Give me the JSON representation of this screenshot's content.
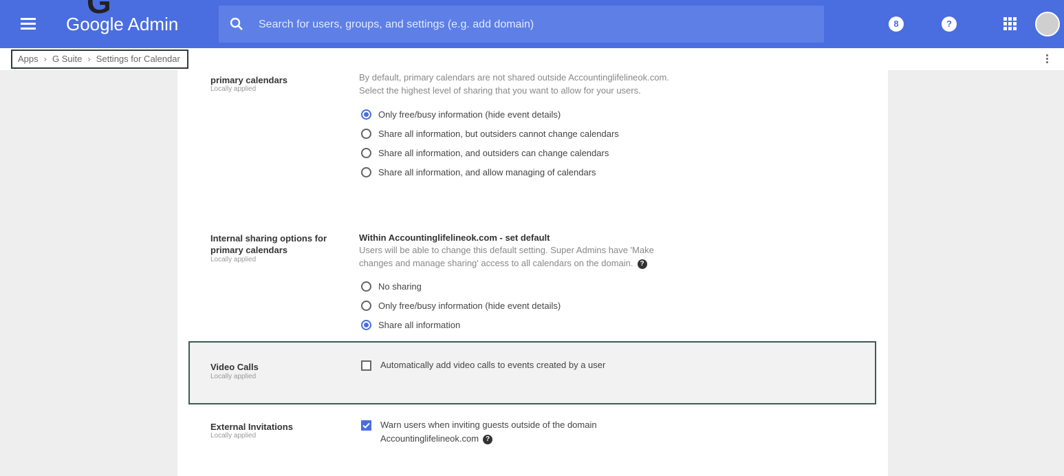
{
  "header": {
    "app_title": "Google Admin",
    "big_g": "G",
    "search_placeholder": "Search for users, groups, and settings (e.g. add domain)",
    "notif_glyph": "8",
    "help_glyph": "?"
  },
  "breadcrumb": {
    "items": [
      "Apps",
      "G Suite",
      "Settings for Calendar"
    ],
    "separator": "›"
  },
  "sections": {
    "external_sharing": {
      "title_line2": "primary calendars",
      "applied": "Locally applied",
      "desc_line1": "By default, primary calendars are not shared outside Accountinglifelineok.com.",
      "desc_line2": "Select the highest level of sharing that you want to allow for your users.",
      "options": [
        "Only free/busy information (hide event details)",
        "Share all information, but outsiders cannot change calendars",
        "Share all information, and outsiders can change calendars",
        "Share all information, and allow managing of calendars"
      ],
      "selected_index": 0
    },
    "internal_sharing": {
      "title_line1": "Internal sharing options for",
      "title_line2": "primary calendars",
      "applied": "Locally applied",
      "heading": "Within Accountinglifelineok.com - set default",
      "desc_line1": "Users will be able to change this default setting. Super Admins have 'Make",
      "desc_line2": "changes and manage sharing' access to all calendars on the domain.",
      "options": [
        "No sharing",
        "Only free/busy information (hide event details)",
        "Share all information"
      ],
      "selected_index": 2
    },
    "video_calls": {
      "title": "Video Calls",
      "applied": "Locally applied",
      "checkbox_label": "Automatically add video calls to events created by a user",
      "checked": false
    },
    "external_invitations": {
      "title": "External Invitations",
      "applied": "Locally applied",
      "checkbox_line1": "Warn users when inviting guests outside of the domain",
      "checkbox_line2": "Accountinglifelineok.com",
      "checked": true
    }
  },
  "colors": {
    "brand_blue": "#4a6ee0",
    "search_bg": "#5d7fe6",
    "highlight_border": "#3e5a57"
  }
}
